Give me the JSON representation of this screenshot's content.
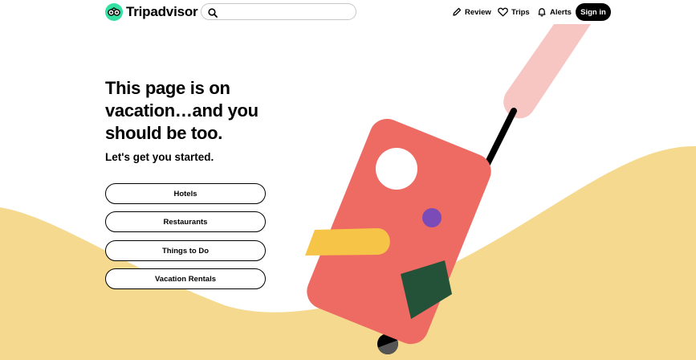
{
  "brand": {
    "name": "Tripadvisor",
    "mark_color": "#34e0a1"
  },
  "search": {
    "value": "",
    "placeholder": ""
  },
  "nav": {
    "review": "Review",
    "trips": "Trips",
    "alerts": "Alerts",
    "sign_in": "Sign in"
  },
  "hero": {
    "headline": "This page is on vacation…and you should be too.",
    "subhead": "Let's get you started."
  },
  "links": [
    "Hotels",
    "Restaurants",
    "Things to Do",
    "Vacation Rentals"
  ],
  "colors": {
    "background_wave": "#f5d98f",
    "suitcase": "#ee6b64",
    "arm": "#f7c6c2",
    "yellow_stripe": "#f6c548",
    "purple_dot": "#7b4cb7",
    "green_patch": "#235238",
    "handle": "#000000"
  }
}
